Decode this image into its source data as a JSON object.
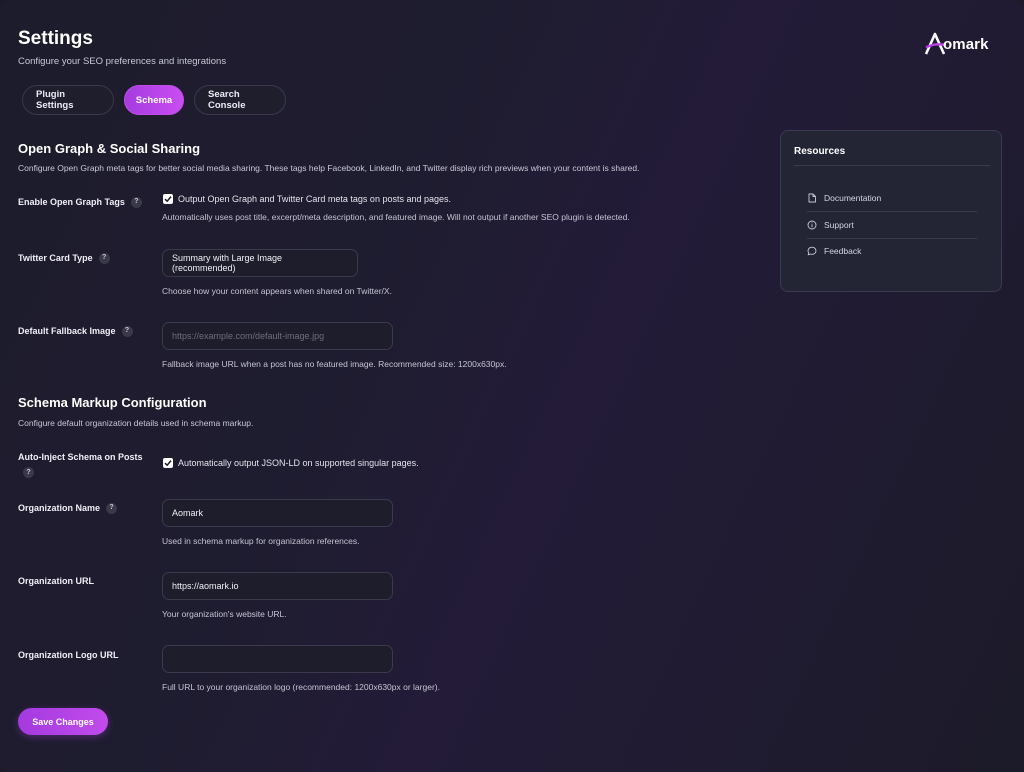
{
  "header": {
    "title": "Settings",
    "subtitle": "Configure your SEO preferences and integrations",
    "logo_text": "omark"
  },
  "tabs": [
    {
      "label": "Plugin Settings",
      "active": false
    },
    {
      "label": "Schema",
      "active": true
    },
    {
      "label": "Search Console",
      "active": false
    }
  ],
  "open_graph": {
    "title": "Open Graph & Social Sharing",
    "description": "Configure Open Graph meta tags for better social media sharing. These tags help Facebook, LinkedIn, and Twitter display rich previews when your content is shared.",
    "enable": {
      "label": "Enable Open Graph Tags",
      "checked": true,
      "checkbox_text": "Output Open Graph and Twitter Card meta tags on posts and pages.",
      "help": "Automatically uses post title, excerpt/meta description, and featured image. Will not output if another SEO plugin is detected."
    },
    "twitter_card": {
      "label": "Twitter Card Type",
      "value": "Summary with Large Image (recommended)",
      "help": "Choose how your content appears when shared on Twitter/X."
    },
    "fallback_image": {
      "label": "Default Fallback Image",
      "value": "",
      "placeholder": "https://example.com/default-image.jpg",
      "help": "Fallback image URL when a post has no featured image. Recommended size: 1200x630px."
    }
  },
  "schema": {
    "title": "Schema Markup Configuration",
    "description": "Configure default organization details used in schema markup.",
    "auto_inject": {
      "label": "Auto-Inject Schema on Posts",
      "checked": true,
      "checkbox_text": "Automatically output JSON-LD on supported singular pages."
    },
    "org_name": {
      "label": "Organization Name",
      "value": "Aomark",
      "help": "Used in schema markup for organization references."
    },
    "org_url": {
      "label": "Organization URL",
      "value": "https://aomark.io",
      "help": "Your organization's website URL."
    },
    "org_logo": {
      "label": "Organization Logo URL",
      "value": "",
      "help": "Full URL to your organization logo (recommended: 1200x630px or larger)."
    }
  },
  "help_icon_glyph": "?",
  "save_label": "Save Changes",
  "resources": {
    "title": "Resources",
    "items": [
      {
        "label": "Documentation",
        "icon": "document-icon"
      },
      {
        "label": "Support",
        "icon": "info-icon"
      },
      {
        "label": "Feedback",
        "icon": "chat-bubble-icon"
      }
    ]
  },
  "colors": {
    "accent": "#b843e8",
    "background": "#1c1b2a",
    "card": "#232434"
  }
}
